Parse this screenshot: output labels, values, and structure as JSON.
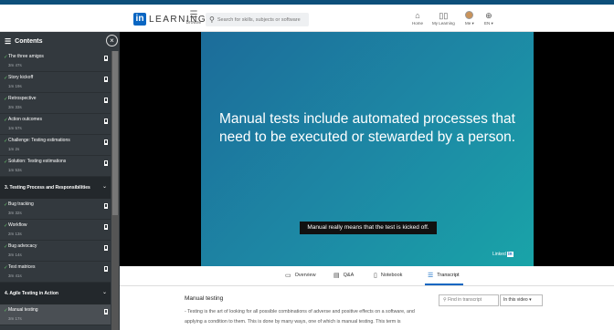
{
  "header": {
    "logo_text": "LEARNING",
    "logo_badge": "in",
    "browse_label": "Browse",
    "search_placeholder": "Search for skills, subjects or software",
    "nav": [
      {
        "label": "Home",
        "icon": "home-icon"
      },
      {
        "label": "My Learning",
        "icon": "book-icon"
      },
      {
        "label": "Me ▾",
        "icon": "avatar"
      },
      {
        "label": "EN ▾",
        "icon": "globe-icon"
      }
    ]
  },
  "sidebar": {
    "title": "Contents",
    "items": [
      {
        "type": "video",
        "title": "The three amigos",
        "duration": "3m 47s"
      },
      {
        "type": "video",
        "title": "Story kickoff",
        "duration": "1m 19s"
      },
      {
        "type": "video",
        "title": "Retrospective",
        "duration": "3m 33s"
      },
      {
        "type": "video",
        "title": "Action outcomes",
        "duration": "1m 57s"
      },
      {
        "type": "video",
        "title": "Challenge: Testing estimations",
        "duration": "1m 2s"
      },
      {
        "type": "video",
        "title": "Solution: Testing estimations",
        "duration": "1m 53s"
      },
      {
        "type": "section",
        "title": "3. Testing Process and Responsibilities"
      },
      {
        "type": "video",
        "title": "Bug tracking",
        "duration": "3m 32s"
      },
      {
        "type": "video",
        "title": "Workflow",
        "duration": "2m 13s"
      },
      {
        "type": "video",
        "title": "Bug advocacy",
        "duration": "3m 14s"
      },
      {
        "type": "video",
        "title": "Test matrices",
        "duration": "3m 41s"
      },
      {
        "type": "section",
        "title": "4. Agile Testing in Action"
      },
      {
        "type": "video",
        "title": "Manual testing",
        "duration": "3m 17s",
        "active": true
      }
    ]
  },
  "video": {
    "slide_text": "Manual tests include automated processes that need to be executed or stewarded by a person.",
    "caption": "Manual really means that the test is kicked off.",
    "watermark": "Linked",
    "watermark_badge": "in"
  },
  "tabs": [
    {
      "label": "Overview",
      "icon": "monitor-icon"
    },
    {
      "label": "Q&A",
      "icon": "chat-icon"
    },
    {
      "label": "Notebook",
      "icon": "notebook-icon"
    },
    {
      "label": "Transcript",
      "icon": "transcript-icon",
      "selected": true
    }
  ],
  "transcript": {
    "title": "Manual testing",
    "text": "- Testing is the art of looking for all possible combinations of adverse and positive effects on a software, and applying a condition to them. This is done by many ways, one of which is manual testing. This term is",
    "search_placeholder": "Find in transcript",
    "scope": "In this video"
  },
  "colors": {
    "accent": "#0a66c2",
    "sidebar_bg": "#33393e",
    "check": "#67c36b"
  }
}
